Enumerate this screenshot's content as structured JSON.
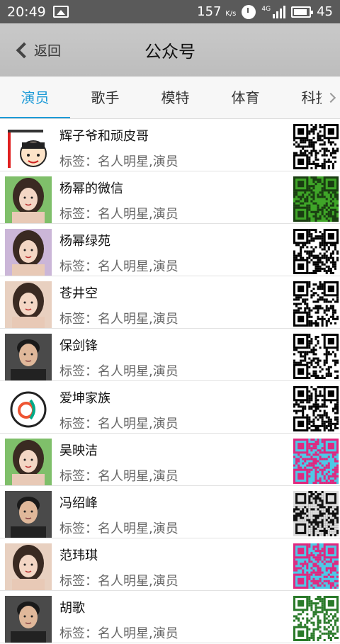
{
  "status": {
    "time": "20:49",
    "speed": "157",
    "speed_unit": "K/s",
    "network": "4G",
    "battery": "45"
  },
  "header": {
    "back_label": "返回",
    "title": "公众号"
  },
  "tabs": [
    {
      "label": "演员",
      "active": true
    },
    {
      "label": "歌手",
      "active": false
    },
    {
      "label": "模特",
      "active": false
    },
    {
      "label": "体育",
      "active": false
    },
    {
      "label": "科技",
      "active": false
    }
  ],
  "accent_color": "#1e9bd7",
  "accounts": [
    {
      "name": "辉子爷和顽皮哥",
      "tag": "标签：名人明星,演员",
      "avatar": "cartoon-avatar",
      "qr_color": "#000000",
      "qr_bg": "#ffffff"
    },
    {
      "name": "杨幂的微信",
      "tag": "标签：名人明星,演员",
      "avatar": "woman-portrait",
      "qr_color": "#1a3d12",
      "qr_bg": "#3fa528"
    },
    {
      "name": "杨幂绿苑",
      "tag": "标签：名人明星,演员",
      "avatar": "woman-portrait",
      "qr_color": "#000000",
      "qr_bg": "#ffffff"
    },
    {
      "name": "苍井空",
      "tag": "标签：名人明星,演员",
      "avatar": "woman-portrait",
      "qr_color": "#000000",
      "qr_bg": "#ffffff"
    },
    {
      "name": "保剑锋",
      "tag": "标签：名人明星,演员",
      "avatar": "man-portrait",
      "qr_color": "#000000",
      "qr_bg": "#ffffff"
    },
    {
      "name": "爱坤家族",
      "tag": "标签：名人明星,演员",
      "avatar": "logo-avatar",
      "qr_color": "#000000",
      "qr_bg": "#ffffff"
    },
    {
      "name": "吴映洁",
      "tag": "标签：名人明星,演员",
      "avatar": "woman-portrait",
      "qr_color": "#e0287f",
      "qr_bg": "#4ec8e6"
    },
    {
      "name": "冯绍峰",
      "tag": "标签：名人明星,演员",
      "avatar": "man-portrait",
      "qr_color": "#dddddd",
      "qr_bg": "#111111"
    },
    {
      "name": "范玮琪",
      "tag": "标签：名人明星,演员",
      "avatar": "woman-portrait",
      "qr_color": "#e0287f",
      "qr_bg": "#4ec8e6"
    },
    {
      "name": "胡歌",
      "tag": "标签：名人明星,演员",
      "avatar": "man-portrait",
      "qr_color": "#2a7a2a",
      "qr_bg": "#ffffff"
    }
  ]
}
